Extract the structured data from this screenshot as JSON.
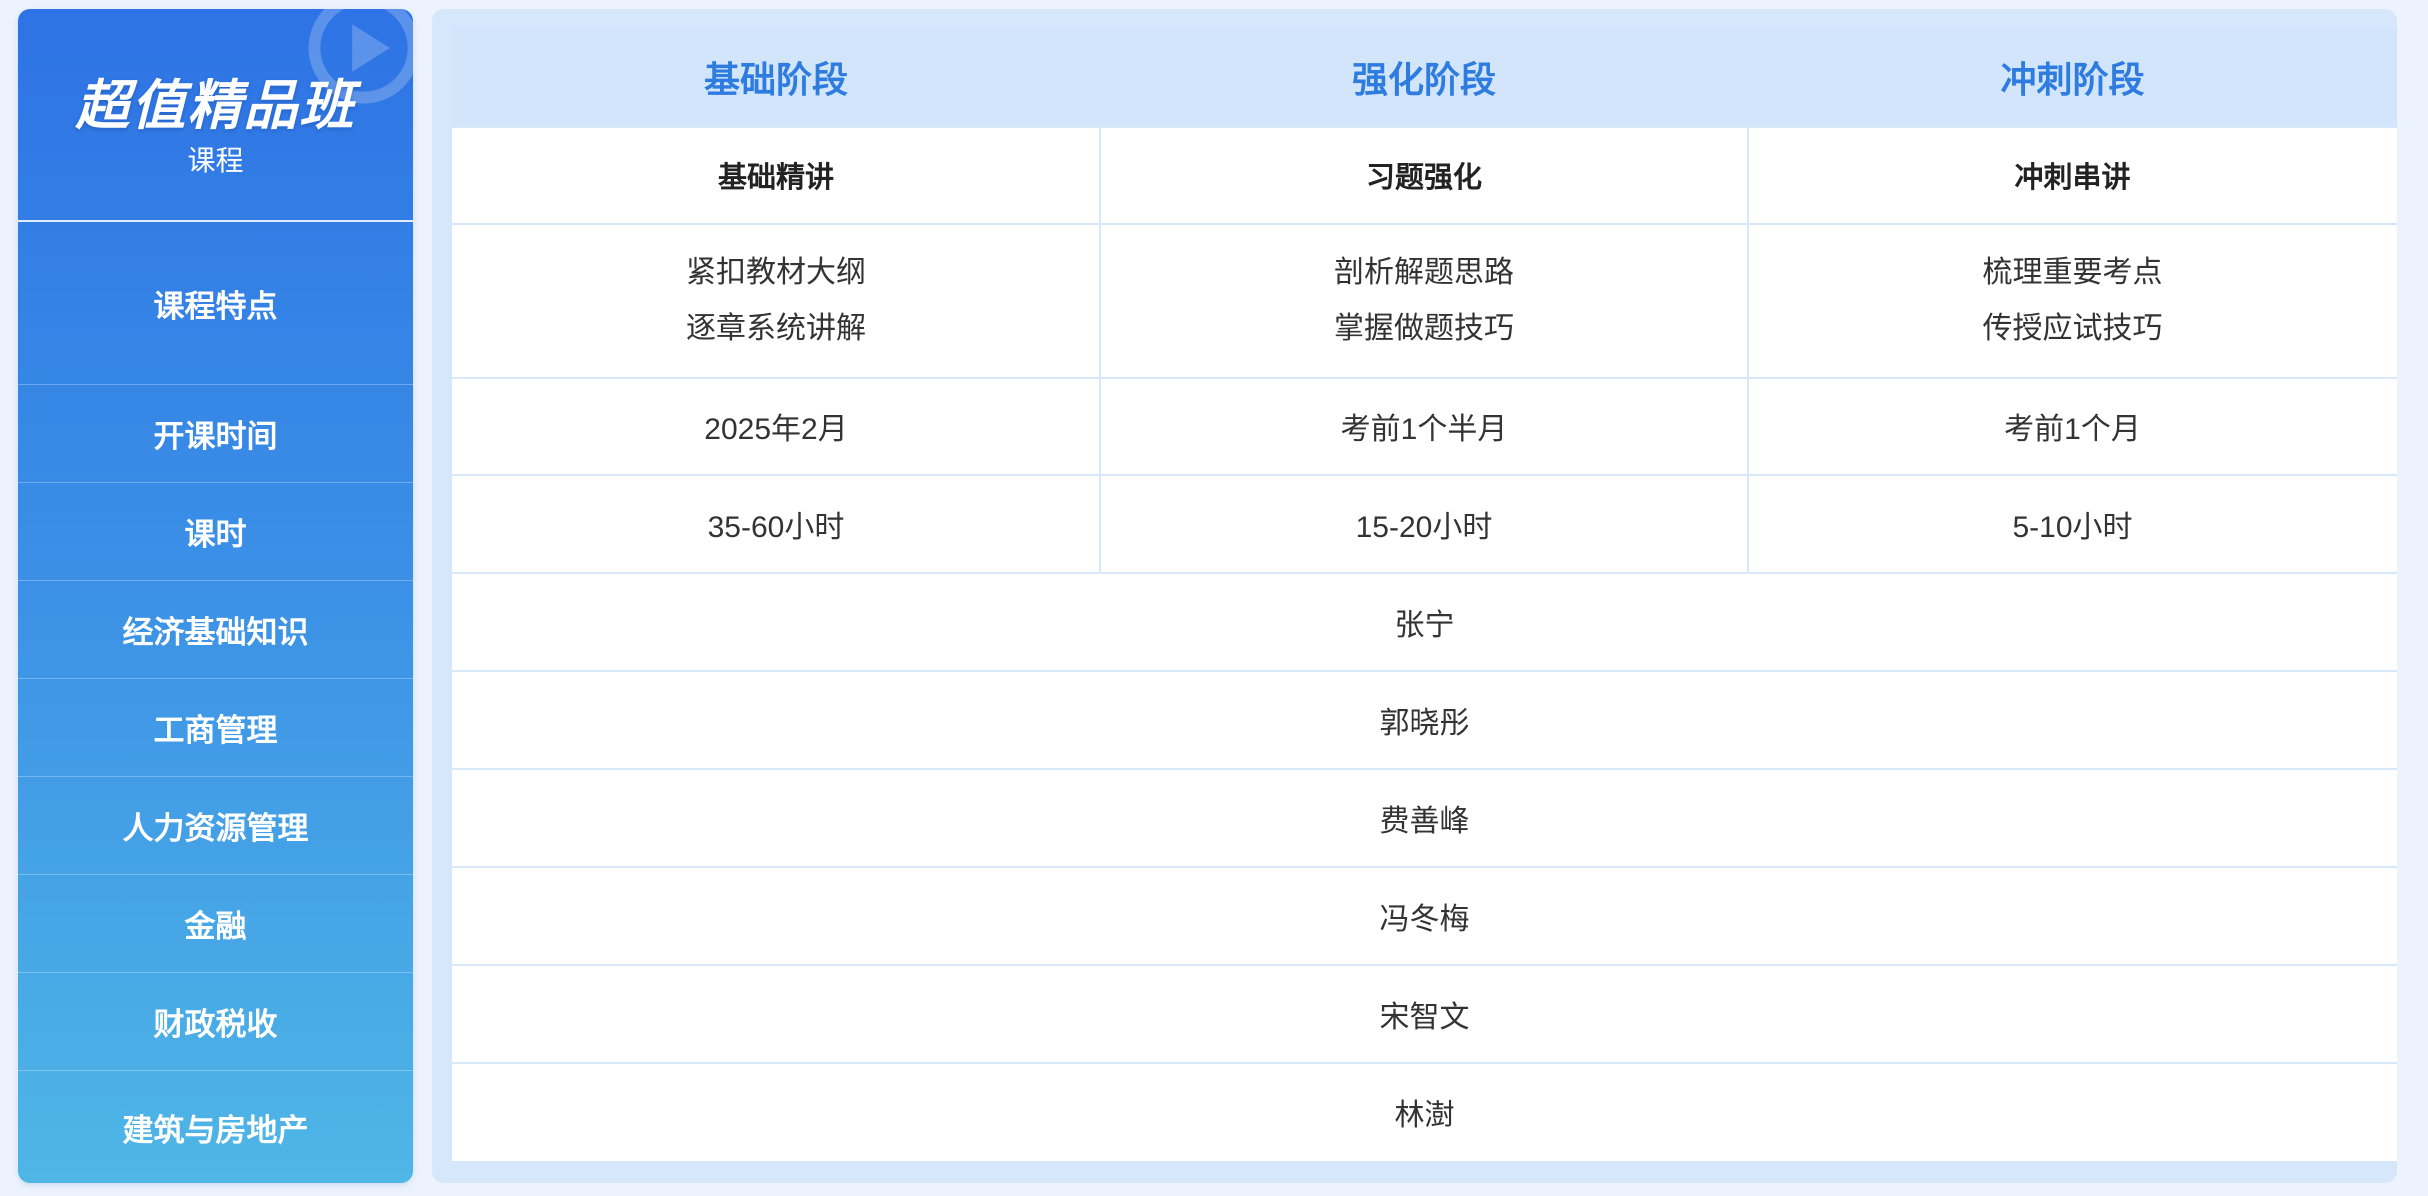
{
  "sidebar": {
    "title": "超值精品班",
    "subtitle": "课程",
    "rows": [
      {
        "label": "课程特点"
      },
      {
        "label": "开课时间"
      },
      {
        "label": "课时"
      },
      {
        "label": "经济基础知识"
      },
      {
        "label": "工商管理"
      },
      {
        "label": "人力资源管理"
      },
      {
        "label": "金融"
      },
      {
        "label": "财政税收"
      },
      {
        "label": "建筑与房地产"
      }
    ]
  },
  "stages": [
    {
      "name": "基础阶段",
      "course": "基础精讲",
      "features": [
        "紧扣教材大纲",
        "逐章系统讲解"
      ],
      "start": "2025年2月",
      "hours": "35-60小时"
    },
    {
      "name": "强化阶段",
      "course": "习题强化",
      "features": [
        "剖析解题思路",
        "掌握做题技巧"
      ],
      "start": "考前1个半月",
      "hours": "15-20小时"
    },
    {
      "name": "冲刺阶段",
      "course": "冲刺串讲",
      "features": [
        "梳理重要考点",
        "传授应试技巧"
      ],
      "start": "考前1个月",
      "hours": "5-10小时"
    }
  ],
  "teachers": [
    {
      "subject": "经济基础知识",
      "name": "张宁"
    },
    {
      "subject": "工商管理",
      "name": "郭晓彤"
    },
    {
      "subject": "人力资源管理",
      "name": "费善峰"
    },
    {
      "subject": "金融",
      "name": "冯冬梅"
    },
    {
      "subject": "财政税收",
      "name": "宋智文"
    },
    {
      "subject": "建筑与房地产",
      "name": "林澍"
    }
  ],
  "colors": {
    "accent": "#2e7ce0",
    "sidebar_top": "#2e73e5",
    "sidebar_bottom": "#4fb6e6",
    "header_bg": "#d2e5fb"
  }
}
